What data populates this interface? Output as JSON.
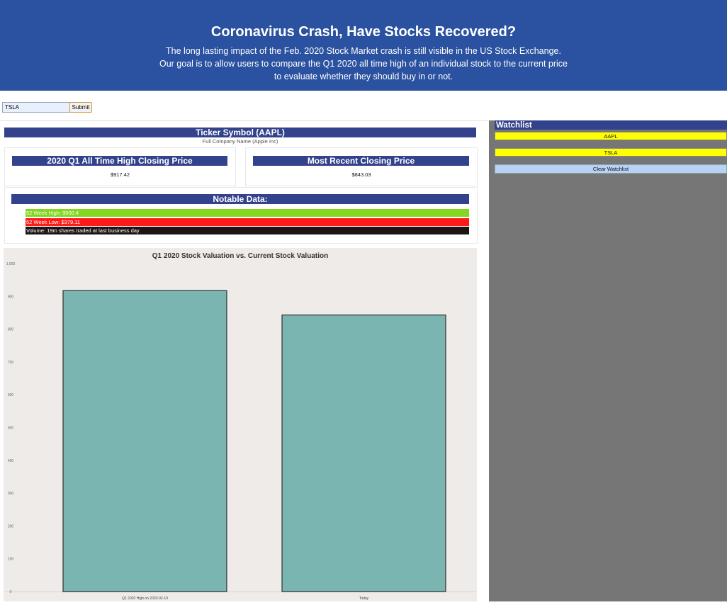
{
  "header": {
    "title": "Coronavirus Crash, Have Stocks Recovered?",
    "lines": [
      "The long lasting impact of the Feb. 2020 Stock Market crash is still visible in the US Stock Exchange.",
      "Our goal is to allow users to compare the Q1 2020 all time high of an individual stock to the current price",
      "to evaluate whether they should buy in or not."
    ]
  },
  "search": {
    "value": "TSLA",
    "submit_label": "Submit"
  },
  "ticker": {
    "title": "Ticker Symbol (AAPL)",
    "company": "Full Company Name (Apple Inc)"
  },
  "high_card": {
    "title": "2020 Q1 All Time High Closing Price",
    "value": "$917.42"
  },
  "recent_card": {
    "title": "Most Recent Closing Price",
    "value": "$843.03"
  },
  "notable": {
    "title": "Notable Data:",
    "rows": [
      {
        "text": "52 Week High: $900.4",
        "color": "#84d621"
      },
      {
        "text": "52 Week Low: $379.11",
        "color": "#ff1a1a"
      },
      {
        "text": "Volume: 19m shares traded at last business day",
        "color": "#1e1414"
      }
    ]
  },
  "watchlist": {
    "title": "Watchlist",
    "items": [
      "AAPL",
      "TSLA"
    ],
    "clear_label": "Clear Watchlist"
  },
  "chart_data": {
    "type": "bar",
    "title": "Q1 2020 Stock Valuation vs. Current Stock Valuation",
    "categories": [
      "Q1 2020 High on 2020-02-19",
      "Today"
    ],
    "values": [
      917.42,
      843.03
    ],
    "ylim": [
      0,
      1000
    ],
    "yticks": [
      "0",
      "100",
      "200",
      "300",
      "400",
      "500",
      "600",
      "700",
      "800",
      "900",
      "1,000"
    ],
    "bar_color": "#7ab5b1",
    "grid": false,
    "legend": "none"
  }
}
